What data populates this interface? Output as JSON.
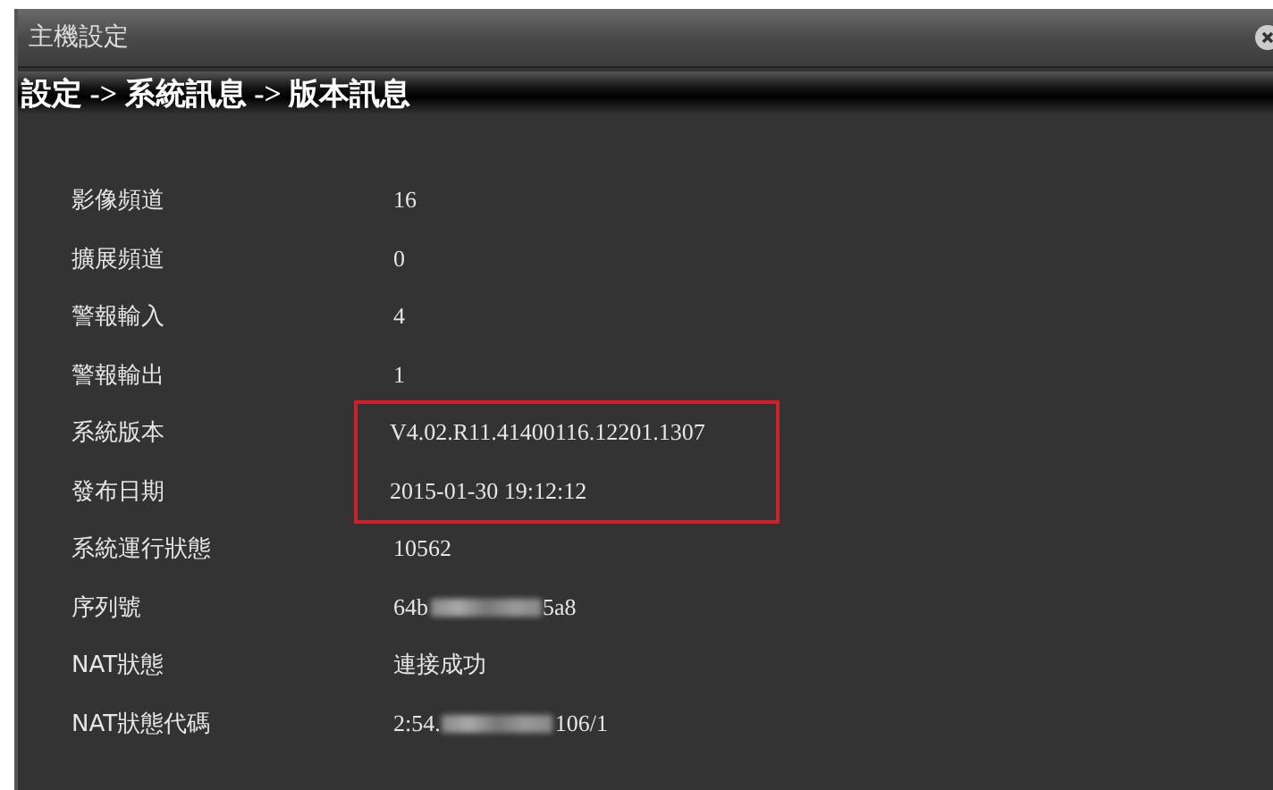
{
  "window": {
    "title": "主機設定"
  },
  "breadcrumb": "設定 -> 系統訊息 -> 版本訊息",
  "rows": [
    {
      "label": "影像頻道",
      "value": "16",
      "highlighted": false
    },
    {
      "label": "擴展頻道",
      "value": "0",
      "highlighted": false
    },
    {
      "label": "警報輸入",
      "value": "4",
      "highlighted": false
    },
    {
      "label": "警報輸出",
      "value": "1",
      "highlighted": false
    },
    {
      "label": "系統版本",
      "value": "V4.02.R11.41400116.12201.1307",
      "highlighted": true
    },
    {
      "label": "發布日期",
      "value": "2015-01-30 19:12:12",
      "highlighted": true
    },
    {
      "label": "系統運行狀態",
      "value": "10562",
      "highlighted": false
    },
    {
      "label": "序列號",
      "value": "64b",
      "value_end": "5a8",
      "redacted": true,
      "highlighted": false
    },
    {
      "label": "NAT狀態",
      "value": "連接成功",
      "highlighted": false
    },
    {
      "label": "NAT狀態代碼",
      "value": "2:54.",
      "value_end": "106/1",
      "redacted": true,
      "highlighted": false
    }
  ]
}
